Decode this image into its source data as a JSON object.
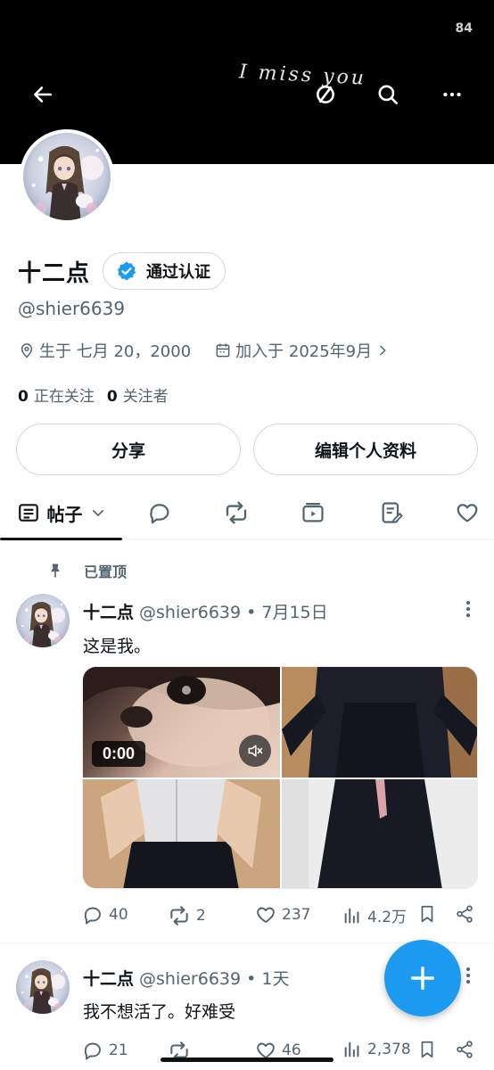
{
  "status_bar": {
    "number": "84"
  },
  "banner": {
    "handwriting": "I miss you"
  },
  "profile": {
    "display_name": "十二点",
    "verified_label": "通过认证",
    "handle": "@shier6639",
    "birthday": "生于 七月 20，2000",
    "joined": "加入于 2025年9月",
    "following_count": "0",
    "following_label": "正在关注",
    "followers_count": "0",
    "followers_label": "关注者"
  },
  "buttons": {
    "share": "分享",
    "edit_profile": "编辑个人资料"
  },
  "tabs": {
    "active_label": "帖子",
    "icons": [
      "reply-icon",
      "repost-icon",
      "video-icon",
      "article-icon",
      "like-icon"
    ]
  },
  "posts": [
    {
      "pinned_label": "已置顶",
      "name": "十二点",
      "handle_date": "@shier6639 • 7月15日",
      "text": "这是我。",
      "video_time": "0:00",
      "replies": "40",
      "reposts": "2",
      "likes": "237",
      "views": "4.2万"
    },
    {
      "name": "十二点",
      "handle_date": "@shier6639 • 1天",
      "text": "我不想活了。好难受",
      "replies": "21",
      "reposts": "",
      "likes": "46",
      "views": "2,378"
    }
  ],
  "colors": {
    "accent": "#1d9bf0",
    "text": "#0f1419",
    "muted": "#536471"
  }
}
